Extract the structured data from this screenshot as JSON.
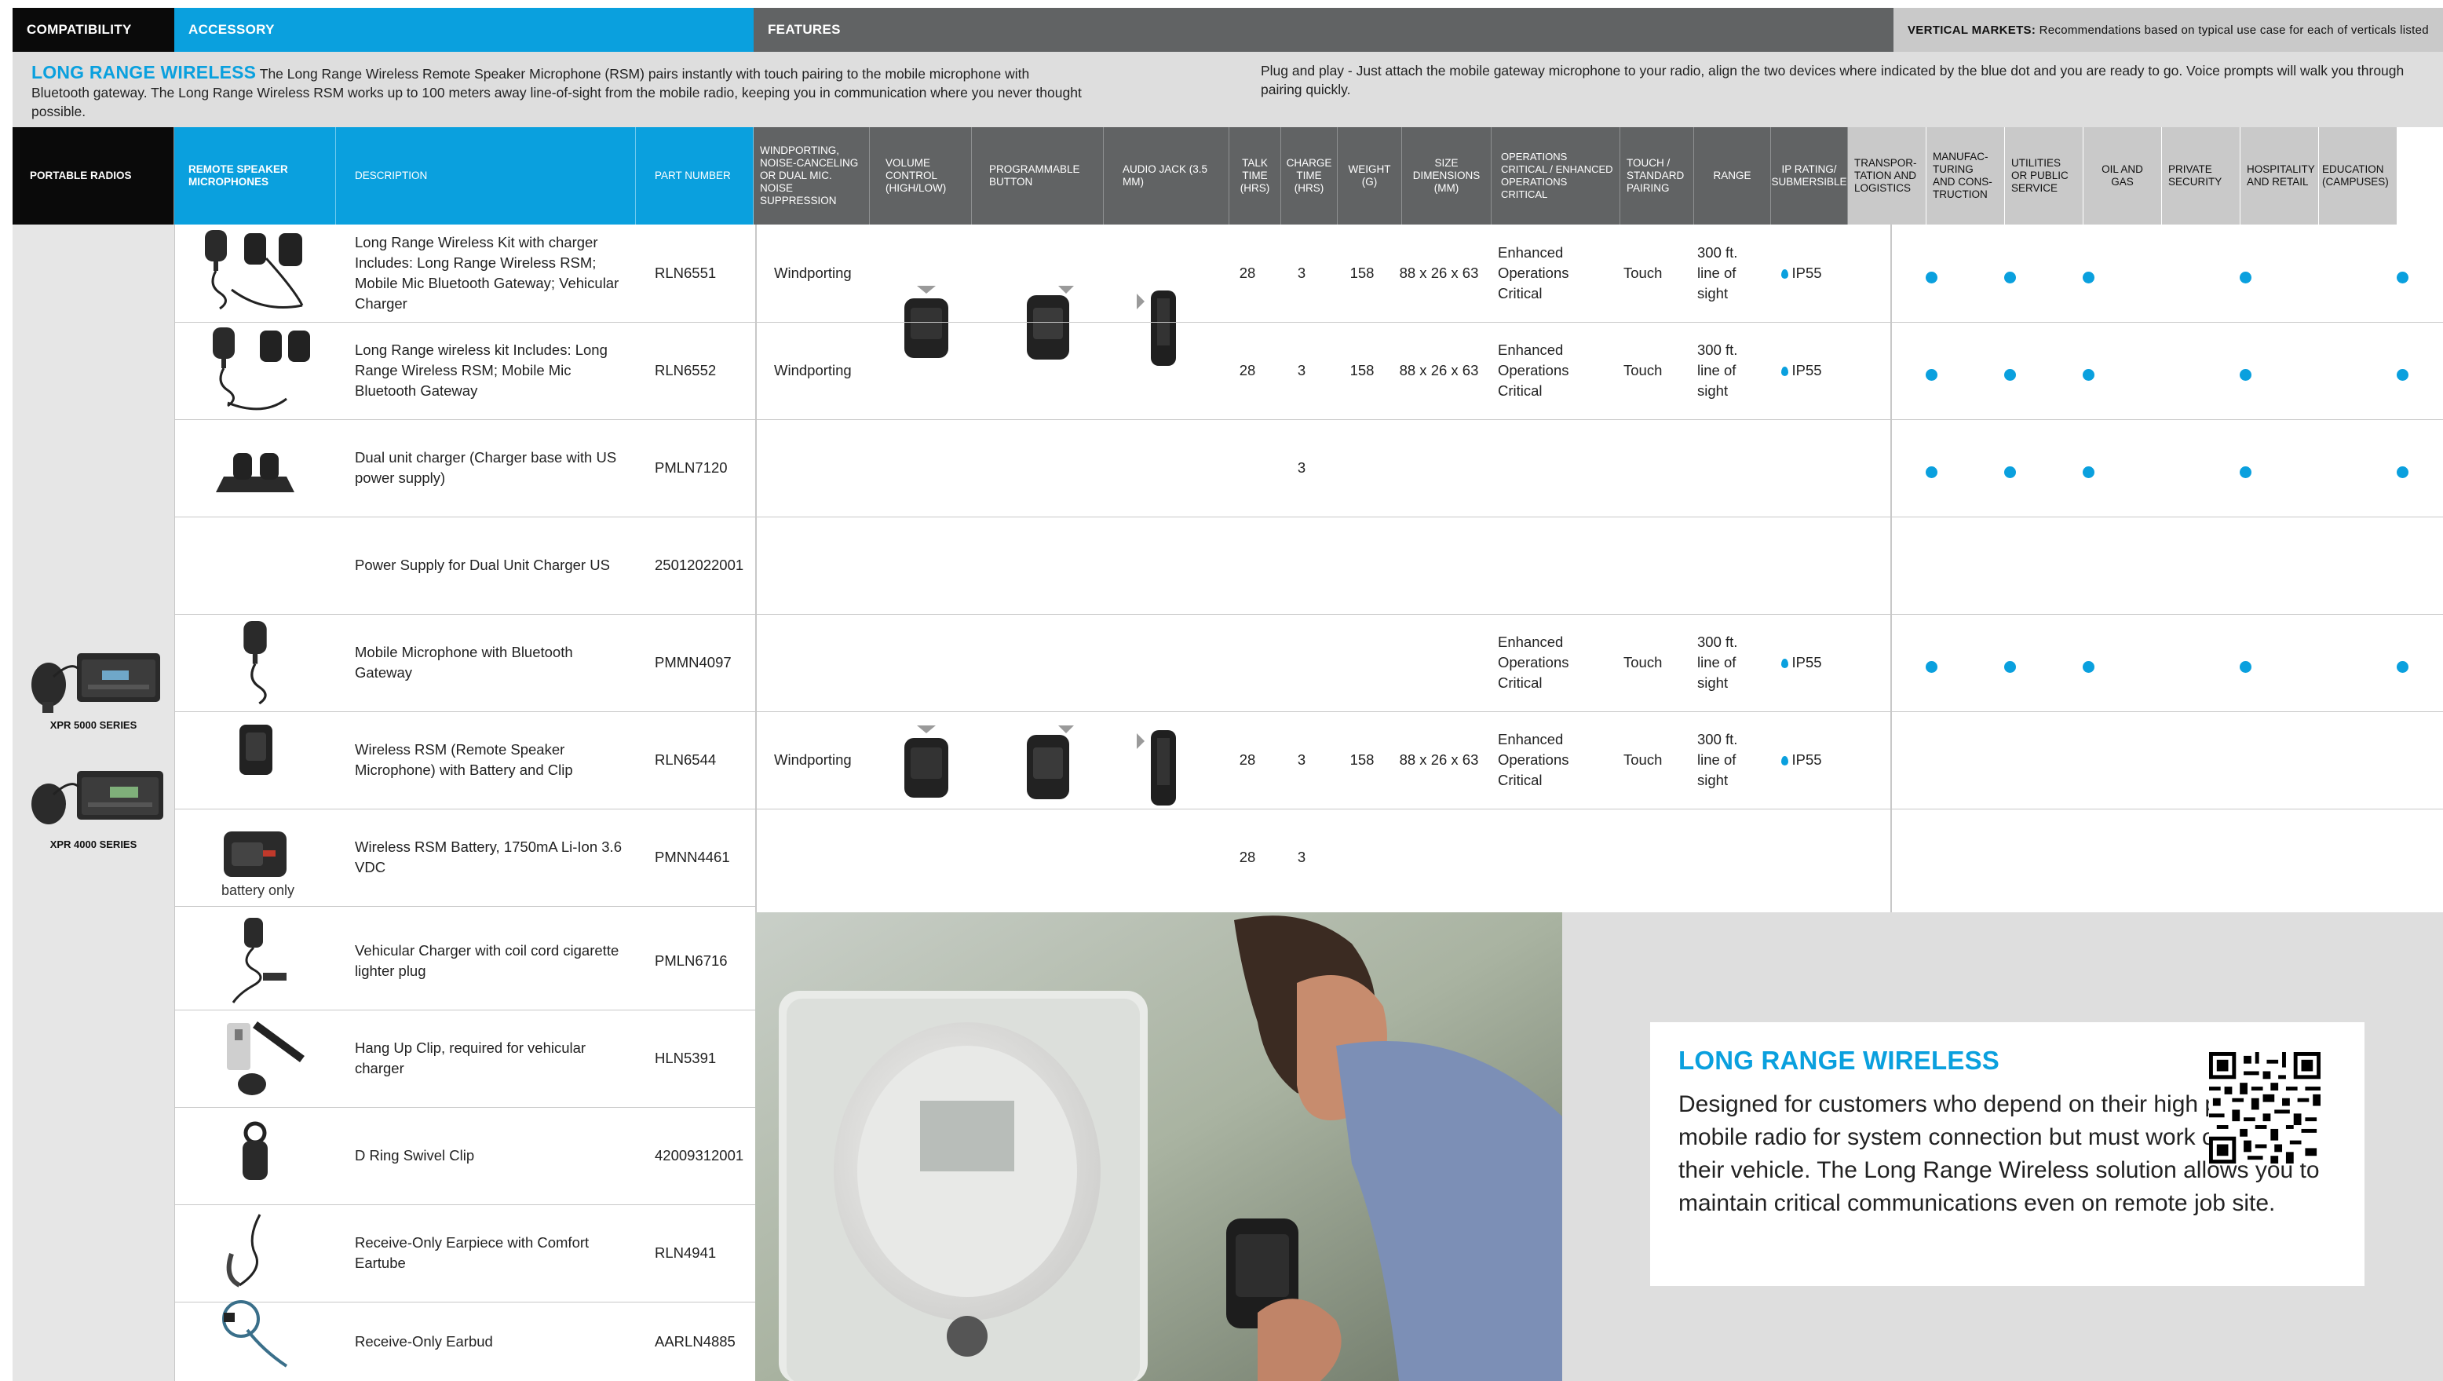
{
  "header": {
    "compatibility": "COMPATIBILITY",
    "accessory": "ACCESSORY",
    "features": "FEATURES",
    "vertical_markets_label": "VERTICAL MARKETS:",
    "vertical_markets_text": "Recommendations based on typical use case for each of verticals listed"
  },
  "intro": {
    "title": "LONG RANGE WIRELESS",
    "left_text": "The Long Range Wireless Remote Speaker Microphone (RSM) pairs instantly with touch pairing to the mobile microphone with Bluetooth gateway. The Long Range Wireless RSM works up to 100 meters away line-of-sight from the mobile radio, keeping you in communication where you never thought possible.",
    "right_text": "Plug and play - Just attach the mobile gateway microphone to your radio, align the two devices where indicated by the blue dot and you are ready to go. Voice prompts will walk you through pairing quickly."
  },
  "columns": {
    "portable_radios": "PORTABLE RADIOS",
    "rsm": "REMOTE SPEAKER MICROPHONES",
    "description": "DESCRIPTION",
    "part_number": "PART NUMBER",
    "windporting": "WINDPORTING, NOISE-CANCELING OR DUAL MIC. NOISE SUPPRESSION",
    "volume": "VOLUME CONTROL (HIGH/LOW)",
    "programmable": "PROGRAMMABLE BUTTON",
    "audio_jack": "AUDIO JACK (3.5 MM)",
    "talk_time": "TALK TIME (HRS)",
    "charge_time": "CHARGE TIME (HRS)",
    "weight": "WEIGHT (G)",
    "size": "SIZE DIMENSIONS (MM)",
    "operations": "OPERATIONS CRITICAL / ENHANCED OPERATIONS CRITICAL",
    "touch": "TOUCH / STANDARD PAIRING",
    "range": "RANGE",
    "ip": "IP RATING/ SUBMERSIBLE",
    "vm": [
      "TRANSPOR-TATION AND LOGISTICS",
      "MANUFAC-TURING AND CONS-TRUCTION",
      "UTILITIES OR PUBLIC SERVICE",
      "OIL AND GAS",
      "PRIVATE SECURITY",
      "HOSPITALITY AND RETAIL",
      "EDUCATION (CAMPUSES)"
    ]
  },
  "compatibility": {
    "series": [
      "XPR 5000 SERIES",
      "XPR 4000 SERIES"
    ]
  },
  "rows": [
    {
      "description": "Long Range Wireless Kit with charger Includes: Long Range Wireless RSM; Mobile Mic Bluetooth Gateway; Vehicular Charger",
      "part": "RLN6551",
      "windporting": "Windporting",
      "talk": "28",
      "charge": "3",
      "weight": "158",
      "size": "88 x 26 x 63",
      "operations": "Enhanced Operations Critical",
      "touch": "Touch",
      "range": "300 ft. line of sight",
      "ip": "IP55",
      "vm": [
        true,
        true,
        true,
        false,
        true,
        false,
        true
      ]
    },
    {
      "description": "Long Range wireless kit Includes:  Long Range Wireless RSM; Mobile Mic Bluetooth Gateway",
      "part": "RLN6552",
      "windporting": "Windporting",
      "talk": "28",
      "charge": "3",
      "weight": "158",
      "size": "88 x 26 x 63",
      "operations": "Enhanced Operations Critical",
      "touch": "Touch",
      "range": "300 ft. line of sight",
      "ip": "IP55",
      "vm": [
        true,
        true,
        true,
        false,
        true,
        false,
        true
      ]
    },
    {
      "description": "Dual unit charger (Charger base with US power supply)",
      "part": "PMLN7120",
      "windporting": "",
      "talk": "",
      "charge": "3",
      "weight": "",
      "size": "",
      "operations": "",
      "touch": "",
      "range": "",
      "ip": "",
      "vm": [
        true,
        true,
        true,
        false,
        true,
        false,
        true
      ]
    },
    {
      "description": "Power Supply for Dual Unit Charger US",
      "part": "25012022001",
      "windporting": "",
      "talk": "",
      "charge": "",
      "weight": "",
      "size": "",
      "operations": "",
      "touch": "",
      "range": "",
      "ip": "",
      "vm": [
        false,
        false,
        false,
        false,
        false,
        false,
        false
      ]
    },
    {
      "description": "Mobile Microphone with Bluetooth Gateway",
      "part": "PMMN4097",
      "windporting": "",
      "talk": "",
      "charge": "",
      "weight": "",
      "size": "",
      "operations": "Enhanced Operations Critical",
      "touch": "Touch",
      "range": "300 ft. line of sight",
      "ip": "IP55",
      "vm": [
        true,
        true,
        true,
        false,
        true,
        false,
        true
      ]
    },
    {
      "description": "Wireless RSM (Remote Speaker Microphone) with Battery and Clip",
      "part": "RLN6544",
      "windporting": "Windporting",
      "talk": "28",
      "charge": "3",
      "weight": "158",
      "size": "88 x 26 x 63",
      "operations": "Enhanced Operations Critical",
      "touch": "Touch",
      "range": "300 ft. line of sight",
      "ip": "IP55",
      "vm": [
        false,
        false,
        false,
        false,
        false,
        false,
        false
      ]
    },
    {
      "description": "Wireless RSM Battery, 1750mA Li-Ion 3.6 VDC",
      "part": "PMNN4461",
      "windporting": "",
      "talk": "28",
      "charge": "3",
      "weight": "",
      "size": "",
      "operations": "",
      "touch": "",
      "range": "",
      "ip": "",
      "vm": [
        false,
        false,
        false,
        false,
        false,
        false,
        false
      ],
      "caption": "battery only"
    },
    {
      "description": "Vehicular Charger with coil cord cigarette lighter plug",
      "part": "PMLN6716"
    },
    {
      "description": "Hang Up Clip, required for vehicular charger",
      "part": "HLN5391"
    },
    {
      "description": "D Ring Swivel Clip",
      "part": "42009312001"
    },
    {
      "description": "Receive-Only Earpiece with Comfort Eartube",
      "part": "RLN4941"
    },
    {
      "description": "Receive-Only Earbud",
      "part": "AARLN4885"
    }
  ],
  "callout": {
    "title": "LONG RANGE WIRELESS",
    "body": "Designed for customers who depend on their high power mobile radio for system connection but must work outside of their vehicle. The Long Range Wireless solution allows you to maintain critical communications even on remote job site."
  },
  "colors": {
    "accent": "#0aa0de",
    "dark": "#0a0a0a",
    "features_grey": "#616364",
    "band_grey": "#dedede"
  }
}
